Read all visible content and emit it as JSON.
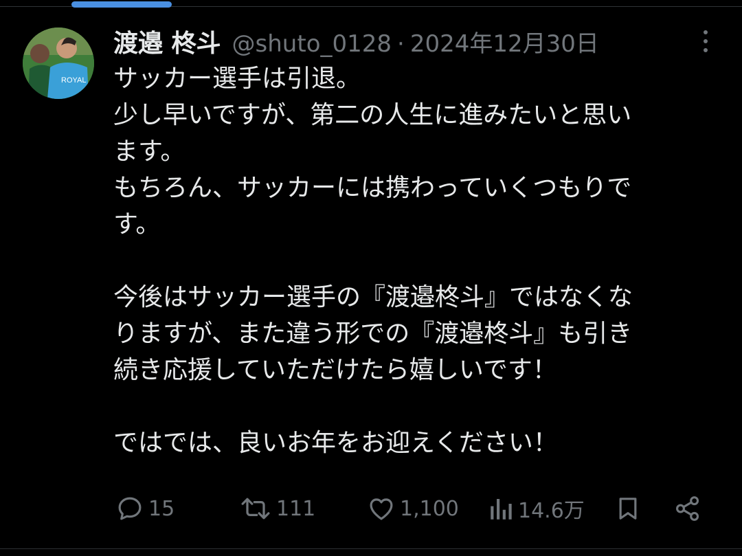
{
  "tweet": {
    "display_name": "渡邉 柊斗",
    "handle": "@shuto_0128",
    "separator": "·",
    "date": "2024年12月30日",
    "body": "サッカー選手は引退。\n少し早いですが、第二の人生に進みたいと思い\nます。\nもちろん、サッカーには携わっていくつもりで\nす。\n\n今後はサッカー選手の『渡邉柊斗』ではなくな\nりますが、また違う形での『渡邉柊斗』も引き\n続き応援していただけたら嬉しいです！\n\nではでは、良いお年をお迎えください！"
  },
  "actions": {
    "reply_count": "15",
    "retweet_count": "111",
    "like_count": "1,100",
    "view_count": "14.6万"
  },
  "icons": {
    "reply": "reply-icon",
    "retweet": "retweet-icon",
    "like": "like-icon",
    "views": "views-icon",
    "bookmark": "bookmark-icon",
    "share": "share-icon",
    "more": "more-icon"
  },
  "colors": {
    "background": "#000000",
    "text_primary": "#e7e9ea",
    "text_secondary": "#71767b",
    "accent": "#4a90e2"
  }
}
